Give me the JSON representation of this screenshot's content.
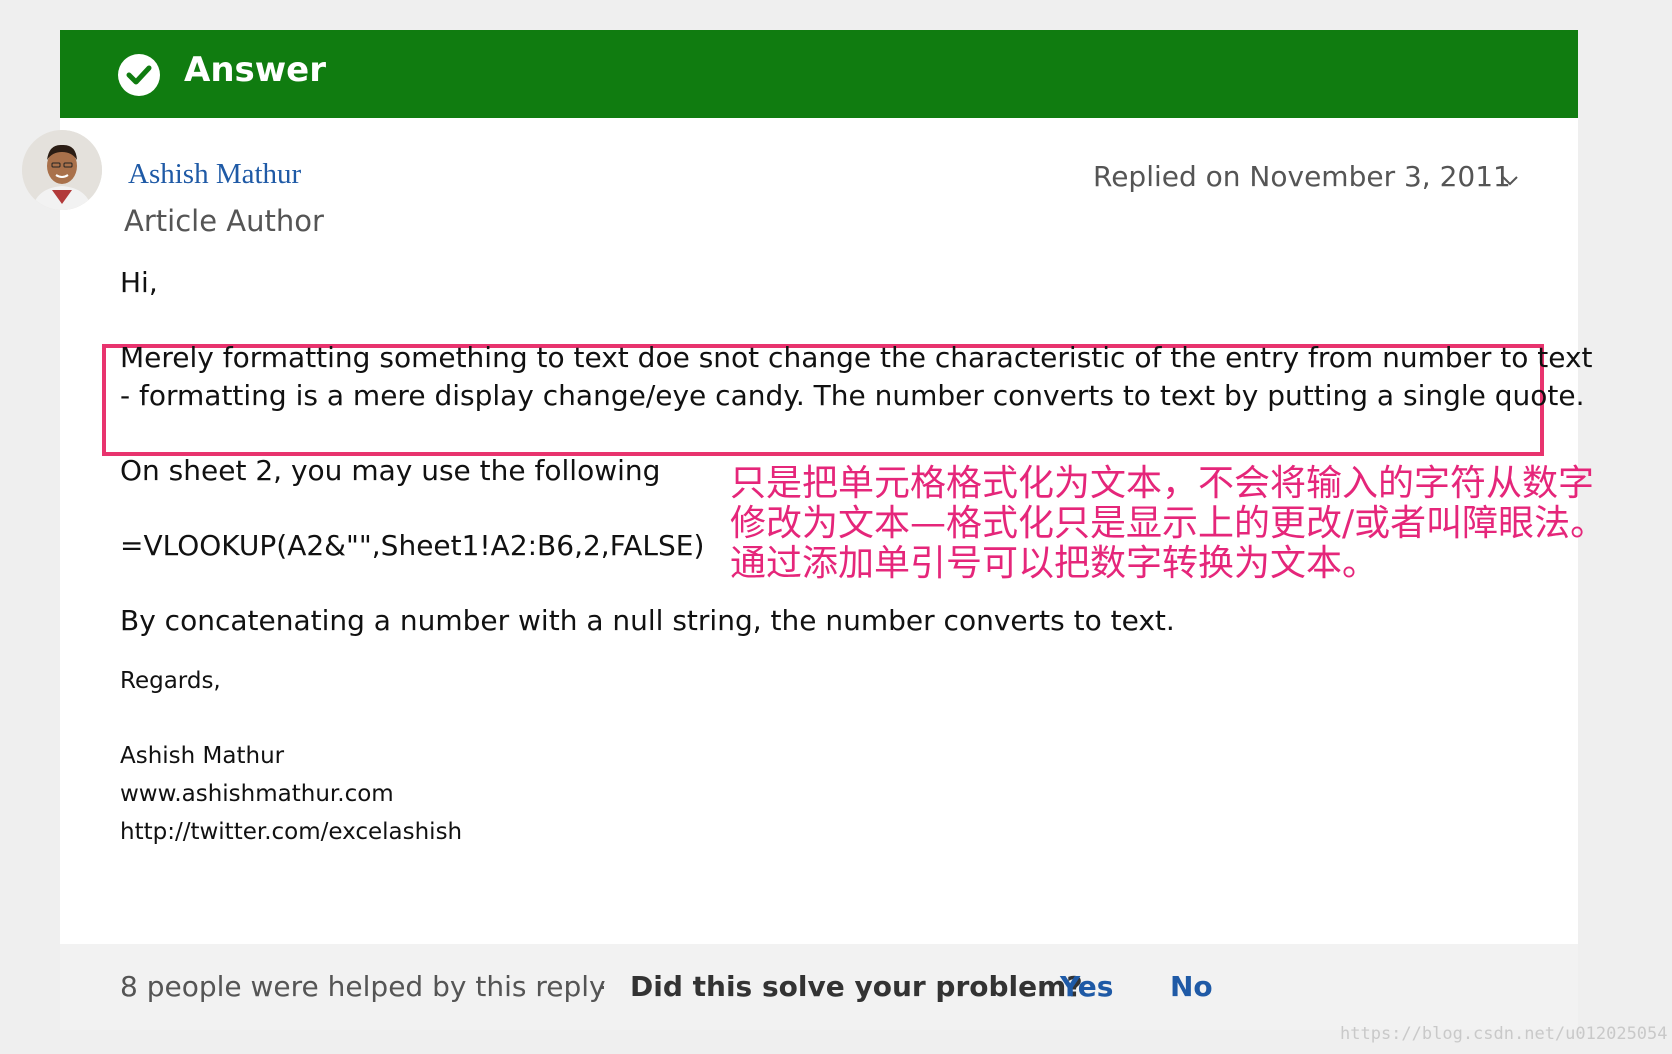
{
  "header": {
    "title": "Answer",
    "icon": "check-circle-icon",
    "color": "#107c10"
  },
  "author": {
    "name": "Ashish Mathur",
    "role": "Article Author",
    "avatar_icon": "avatar"
  },
  "reply": {
    "date": "Replied on November 3, 2011"
  },
  "body": {
    "greeting": "Hi,",
    "highlight_line1": "Merely formatting something to text doe snot change the characteristic of the entry from number to text",
    "highlight_line2": "- formatting is a mere display change/eye candy.  The number converts to text by putting a single quote.",
    "sheet_line": "On sheet 2, you may use the following",
    "formula": "=VLOOKUP(A2&\"\",Sheet1!A2:B6,2,FALSE)",
    "concat_line": "By concatenating a number with a null string, the number converts to text.",
    "regards": "Regards,",
    "sign_name": "Ashish Mathur",
    "sign_site": "www.ashishmathur.com",
    "sign_twitter": "http://twitter.com/excelashish"
  },
  "annotation": {
    "line1": "只是把单元格格式化为文本，不会将输入的字符从数字",
    "line2": "修改为文本—格式化只是显示上的更改/或者叫障眼法。",
    "line3": "通过添加单引号可以把数字转换为文本。",
    "color": "#e5267a"
  },
  "footer": {
    "helped": "8 people were helped by this reply",
    "separator": "·",
    "question": "Did this solve your problem?",
    "yes": "Yes",
    "no": "No"
  },
  "watermark": "https://blog.csdn.net/u012025054"
}
